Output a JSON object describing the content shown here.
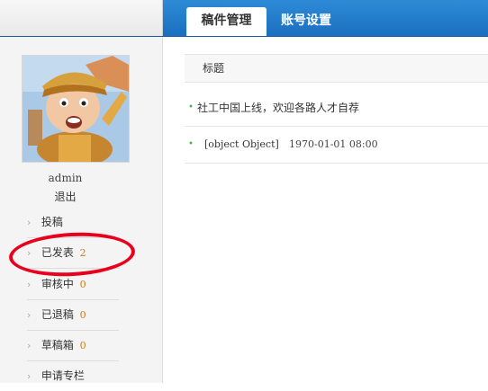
{
  "header": {
    "tabs": [
      {
        "label": "稿件管理",
        "active": true
      },
      {
        "label": "账号设置",
        "active": false
      }
    ]
  },
  "sidebar": {
    "username": "admin",
    "logout": "退出",
    "items": [
      {
        "label": "投稿",
        "count": ""
      },
      {
        "label": "已发表",
        "count": "2"
      },
      {
        "label": "审核中",
        "count": "0"
      },
      {
        "label": "已退稿",
        "count": "0"
      },
      {
        "label": "草稿箱",
        "count": "0"
      },
      {
        "label": "申请专栏",
        "count": ""
      }
    ]
  },
  "main": {
    "column_header": "标题",
    "rows": [
      {
        "title": "社工中国上线，欢迎各路人才自荐",
        "date": ""
      },
      {
        "title": "[object Object]",
        "date": "1970-01-01 08:00"
      }
    ]
  },
  "colors": {
    "header_blue": "#1a6fc0",
    "count_orange": "#d07a10",
    "annotation_red": "#e8001c"
  }
}
